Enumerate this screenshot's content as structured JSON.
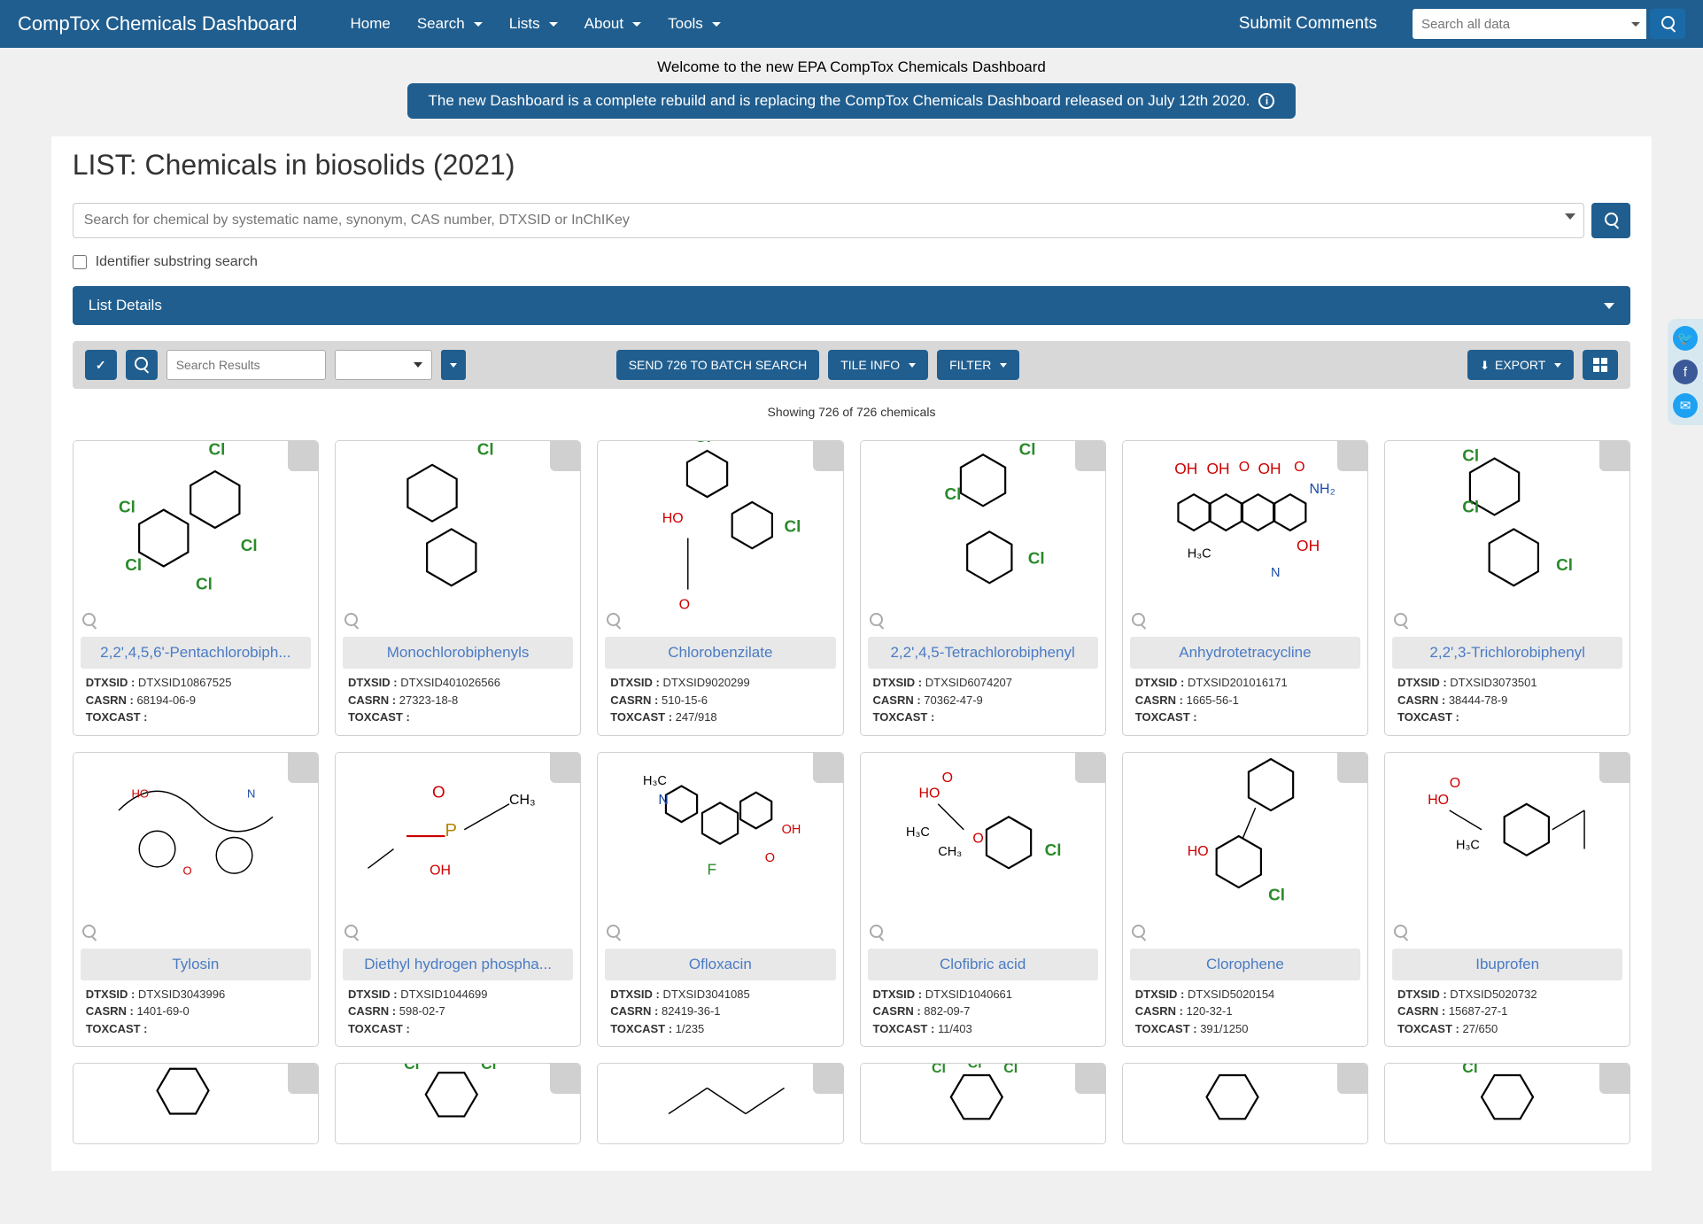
{
  "nav": {
    "brand": "CompTox Chemicals Dashboard",
    "items": [
      "Home",
      "Search",
      "Lists",
      "About",
      "Tools"
    ],
    "dropdown_items": [
      false,
      true,
      true,
      true,
      true
    ],
    "submit": "Submit Comments",
    "global_search_placeholder": "Search all data"
  },
  "welcome": "Welcome to the new EPA CompTox Chemicals Dashboard",
  "banner": "The new Dashboard is a complete rebuild and is replacing the CompTox Chemicals Dashboard released on July 12th 2020.",
  "page_title": "LIST: Chemicals in biosolids (2021)",
  "chem_search_placeholder": "Search for chemical by systematic name, synonym, CAS number, DTXSID or InChIKey",
  "substring_label": "Identifier substring search",
  "list_details_label": "List Details",
  "toolbar": {
    "search_results_placeholder": "Search Results",
    "batch": "SEND 726 TO BATCH SEARCH",
    "tile_info": "TILE INFO",
    "filter": "FILTER",
    "export": "EXPORT"
  },
  "showing": "Showing 726 of 726 chemicals",
  "labels": {
    "dtxsid": "DTXSID :",
    "casrn": "CASRN :",
    "toxcast": "TOXCAST :"
  },
  "chemicals": [
    {
      "name": "2,2',4,5,6'-Pentachlorobiph...",
      "dtxsid": "DTXSID10867525",
      "casrn": "68194-06-9",
      "toxcast": ""
    },
    {
      "name": "Monochlorobiphenyls",
      "dtxsid": "DTXSID401026566",
      "casrn": "27323-18-8",
      "toxcast": ""
    },
    {
      "name": "Chlorobenzilate",
      "dtxsid": "DTXSID9020299",
      "casrn": "510-15-6",
      "toxcast": "247/918"
    },
    {
      "name": "2,2',4,5-Tetrachlorobiphenyl",
      "dtxsid": "DTXSID6074207",
      "casrn": "70362-47-9",
      "toxcast": ""
    },
    {
      "name": "Anhydrotetracycline",
      "dtxsid": "DTXSID201016171",
      "casrn": "1665-56-1",
      "toxcast": ""
    },
    {
      "name": "2,2',3-Trichlorobiphenyl",
      "dtxsid": "DTXSID3073501",
      "casrn": "38444-78-9",
      "toxcast": ""
    },
    {
      "name": "Tylosin",
      "dtxsid": "DTXSID3043996",
      "casrn": "1401-69-0",
      "toxcast": ""
    },
    {
      "name": "Diethyl hydrogen phospha...",
      "dtxsid": "DTXSID1044699",
      "casrn": "598-02-7",
      "toxcast": ""
    },
    {
      "name": "Ofloxacin",
      "dtxsid": "DTXSID3041085",
      "casrn": "82419-36-1",
      "toxcast": "1/235"
    },
    {
      "name": "Clofibric acid",
      "dtxsid": "DTXSID1040661",
      "casrn": "882-09-7",
      "toxcast": "11/403"
    },
    {
      "name": "Clorophene",
      "dtxsid": "DTXSID5020154",
      "casrn": "120-32-1",
      "toxcast": "391/1250"
    },
    {
      "name": "Ibuprofen",
      "dtxsid": "DTXSID5020732",
      "casrn": "15687-27-1",
      "toxcast": "27/650"
    }
  ]
}
